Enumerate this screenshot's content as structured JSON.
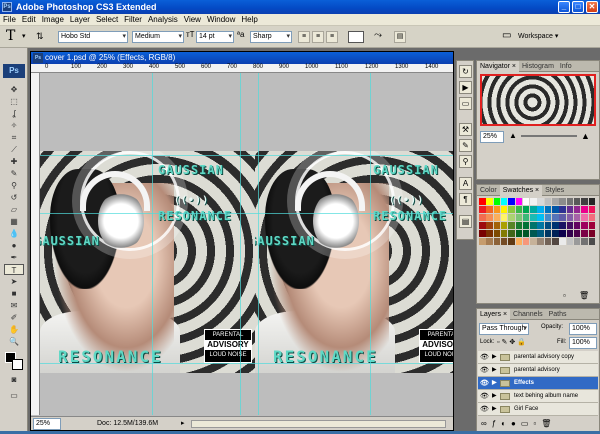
{
  "window": {
    "title": "Adobe Photoshop CS3 Extended",
    "controls": [
      "_",
      "□",
      "✕"
    ]
  },
  "menu": [
    "File",
    "Edit",
    "Image",
    "Layer",
    "Select",
    "Filter",
    "Analysis",
    "View",
    "Window",
    "Help"
  ],
  "options": {
    "tool_glyph": "T",
    "font_family": "Hobo Std",
    "font_style": "Medium",
    "font_size": "14 pt",
    "anti_alias": "Sharp",
    "workspace": "Workspace ▾"
  },
  "document": {
    "title": "cover 1.psd @ 25% (Effects, RGB/8)",
    "ruler_marks": [
      "0",
      "100",
      "200",
      "300",
      "400",
      "500",
      "600",
      "700",
      "800",
      "900",
      "1000",
      "1100",
      "1200",
      "1300",
      "1400"
    ],
    "zoom": "25%",
    "doc_info": "Doc: 12.5M/139.6M",
    "artwork": {
      "brand_top": "GAUSSIAN",
      "brand_signal": "((•))",
      "brand_resonance": "RESONANCE",
      "vertical_text": "GAUSSIAN",
      "bottom_text": "RESONANCE",
      "advisory_top": "PARENTAL",
      "advisory_mid": "ADVISORY",
      "advisory_bottom": "LOUD NOISE"
    }
  },
  "panels": {
    "navigator_tabs": [
      "Navigator ×",
      "Histogram",
      "Info"
    ],
    "navigator_zoom": "25%",
    "swatch_tabs": [
      "Color",
      "Swatches ×",
      "Styles"
    ],
    "swatch_colors": [
      "#ff0000",
      "#ffff00",
      "#00ff00",
      "#00ffff",
      "#0000ff",
      "#ff00ff",
      "#ffffff",
      "#f2f2f2",
      "#d9d9d9",
      "#bfbfbf",
      "#a6a6a6",
      "#8c8c8c",
      "#737373",
      "#595959",
      "#404040",
      "#262626",
      "#ed1c24",
      "#f26522",
      "#f7941d",
      "#fff200",
      "#8dc63f",
      "#39b54a",
      "#00a651",
      "#00a99d",
      "#00aeef",
      "#0072bc",
      "#0054a6",
      "#2e3192",
      "#662d91",
      "#92278f",
      "#ec008c",
      "#ed145b",
      "#f26c4f",
      "#f68e55",
      "#fbaf5c",
      "#fff467",
      "#acd372",
      "#7cc576",
      "#3bb878",
      "#1abbb4",
      "#00bff3",
      "#448ccb",
      "#5674b9",
      "#605ca8",
      "#855fa8",
      "#a763a8",
      "#f06eaa",
      "#f26d7d",
      "#9e0b0f",
      "#a0410d",
      "#a36209",
      "#aba000",
      "#598527",
      "#197b30",
      "#007236",
      "#00746b",
      "#0076a3",
      "#004b80",
      "#003471",
      "#1b1464",
      "#440e62",
      "#630460",
      "#9e005d",
      "#9e0039",
      "#790000",
      "#7b2e00",
      "#7d4900",
      "#827b00",
      "#406618",
      "#005e20",
      "#005826",
      "#005952",
      "#005b7f",
      "#003663",
      "#002157",
      "#0d004c",
      "#32004b",
      "#4b0049",
      "#7b0046",
      "#7a0026",
      "#c69c6d",
      "#a67c52",
      "#8c6239",
      "#754c24",
      "#603913",
      "#fbaf5d",
      "#f7977a",
      "#c7b299",
      "#998675",
      "#736357",
      "#534741",
      "#ebebeb",
      "#c2c2c2",
      "#9a9a9a",
      "#727272",
      "#4b4b4b"
    ],
    "layer_tabs": [
      "Layers ×",
      "Channels",
      "Paths"
    ],
    "blend_mode": "Pass Through",
    "opacity_label": "Opacity:",
    "opacity": "100%",
    "lock_label": "Lock:",
    "fill_label": "Fill:",
    "fill": "100%",
    "layers": [
      {
        "name": "parental advisory copy",
        "selected": false
      },
      {
        "name": "parental advisory",
        "selected": false
      },
      {
        "name": "Effects",
        "selected": true
      },
      {
        "name": "text behing album name",
        "selected": false
      },
      {
        "name": "Girl Face",
        "selected": false
      }
    ]
  },
  "colors": {
    "title_blue": "#0449c4",
    "accent_teal": "#5fd8c5",
    "selection": "#316ac5"
  }
}
